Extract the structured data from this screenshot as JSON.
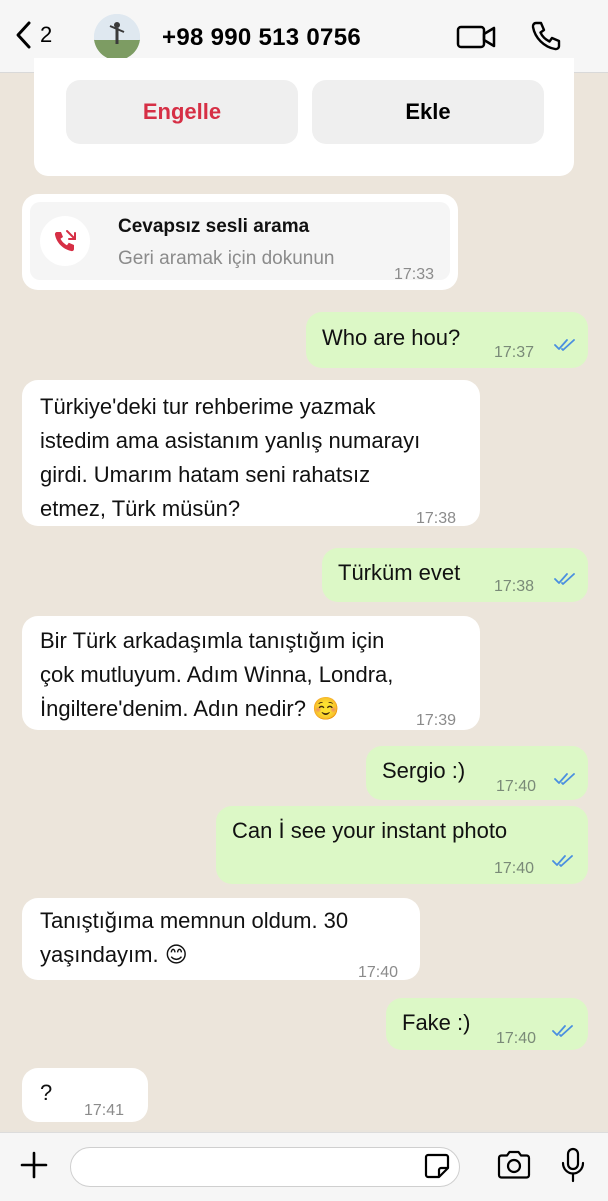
{
  "header": {
    "back_count": "2",
    "contact_name": "+98 990 513 0756"
  },
  "top_card": {
    "block_label": "Engelle",
    "add_label": "Ekle"
  },
  "missed_call": {
    "title": "Cevapsız sesli arama",
    "subtitle": "Geri aramak için dokunun",
    "time": "17:33"
  },
  "messages": [
    {
      "text": "Who are hou?",
      "time": "17:37",
      "direction": "out"
    },
    {
      "lines": [
        "Türkiye'deki tur rehberime yazmak",
        "istedim ama asistanım yanlış numarayı",
        "girdi. Umarım hatam seni rahatsız",
        "etmez, Türk müsün?"
      ],
      "time": "17:38",
      "direction": "in"
    },
    {
      "text": "Türküm evet",
      "time": "17:38",
      "direction": "out"
    },
    {
      "lines": [
        "Bir Türk arkadaşımla tanıştığım için",
        "çok mutluyum. Adım Winna, Londra,",
        "İngiltere'denim. Adın nedir? ☺️"
      ],
      "time": "17:39",
      "direction": "in"
    },
    {
      "text": "Sergio :)",
      "time": "17:40",
      "direction": "out"
    },
    {
      "text": "Can İ see your instant photo",
      "time": "17:40",
      "direction": "out"
    },
    {
      "lines": [
        "Tanıştığıma memnun oldum. 30",
        "yaşındayım. 😊"
      ],
      "time": "17:40",
      "direction": "in"
    },
    {
      "text": "Fake :)",
      "time": "17:40",
      "direction": "out"
    },
    {
      "text": "?",
      "time": "17:41",
      "direction": "in"
    }
  ],
  "colors": {
    "accent_red": "#d62f45",
    "outgoing_bubble": "#dcf8c6",
    "incoming_bubble": "#ffffff",
    "read_ticks": "#4a8fe0",
    "wallpaper": "#ece5db"
  },
  "icons": [
    "chevron-left-icon",
    "video-icon",
    "phone-icon",
    "missed-call-icon",
    "plus-icon",
    "sticker-icon",
    "camera-icon",
    "mic-icon",
    "double-check-icon"
  ]
}
